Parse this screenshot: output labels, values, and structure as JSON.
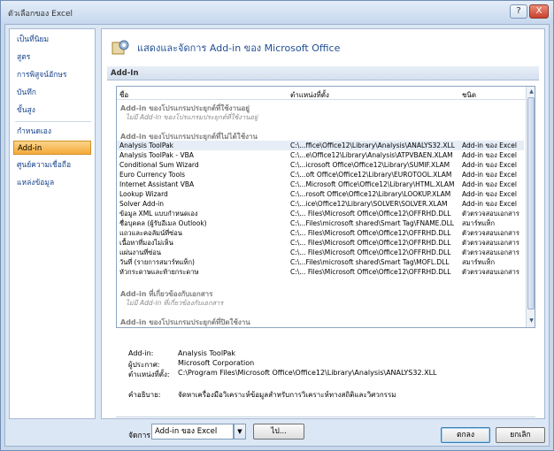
{
  "window": {
    "title": "ตัวเลือกของ Excel",
    "help": "?",
    "close": "X"
  },
  "sidebar": {
    "items": [
      {
        "label": "เป็นที่นิยม"
      },
      {
        "label": "สูตร"
      },
      {
        "label": "การพิสูจน์อักษร"
      },
      {
        "label": "บันทึก"
      },
      {
        "label": "ขั้นสูง"
      },
      {
        "label": "กำหนดเอง"
      },
      {
        "label": "Add-in"
      },
      {
        "label": "ศูนย์ความเชื่อถือ"
      },
      {
        "label": "แหล่งข้อมูล"
      }
    ]
  },
  "header": {
    "text": "แสดงและจัดการ  Add-in ของ Microsoft Office"
  },
  "section": {
    "title": "Add-In"
  },
  "list": {
    "columns": {
      "name": "ชื่อ",
      "location": "ตำแหน่งที่ตั้ง",
      "type": "ชนิด"
    },
    "active_group": {
      "title": "Add-in ของโปรแกรมประยุกต์ที่ใช้งานอยู่",
      "empty": "ไม่มี Add-in ของโปรแกรมประยุกต์ที่ใช้งานอยู่"
    },
    "inactive_group": {
      "title": "Add-in ของโปรแกรมประยุกต์ที่ไม่ได้ใช้งาน"
    },
    "rows": [
      {
        "name": "Analysis ToolPak",
        "location": "C:\\...ffice\\Office12\\Library\\Analysis\\ANALYS32.XLL",
        "type": "Add-in ของ Excel"
      },
      {
        "name": "Analysis ToolPak - VBA",
        "location": "C:\\...e\\Office12\\Library\\Analysis\\ATPVBAEN.XLAM",
        "type": "Add-in ของ Excel"
      },
      {
        "name": "Conditional Sum Wizard",
        "location": "C:\\...icrosoft Office\\Office12\\Library\\SUMIF.XLAM",
        "type": "Add-in ของ Excel"
      },
      {
        "name": "Euro Currency Tools",
        "location": "C:\\...oft Office\\Office12\\Library\\EUROTOOL.XLAM",
        "type": "Add-in ของ Excel"
      },
      {
        "name": "Internet Assistant VBA",
        "location": "C:\\...Microsoft Office\\Office12\\Library\\HTML.XLAM",
        "type": "Add-in ของ Excel"
      },
      {
        "name": "Lookup Wizard",
        "location": "C:\\...rosoft Office\\Office12\\Library\\LOOKUP.XLAM",
        "type": "Add-in ของ Excel"
      },
      {
        "name": "Solver Add-in",
        "location": "C:\\...ice\\Office12\\Library\\SOLVER\\SOLVER.XLAM",
        "type": "Add-in ของ Excel"
      },
      {
        "name": "ข้อมูล XML แบบกำหนดเอง",
        "location": "C:\\... Files\\Microsoft Office\\Office12\\OFFRHD.DLL",
        "type": "ตัวตรวจสอบเอกสาร"
      },
      {
        "name": "ชื่อบุคคล (ผู้รับอีเมล Outlook)",
        "location": "C:\\...Files\\microsoft shared\\Smart Tag\\FNAME.DLL",
        "type": "สมาร์ทแท็ก"
      },
      {
        "name": "แถวและคอลัมน์ที่ซ่อน",
        "location": "C:\\... Files\\Microsoft Office\\Office12\\OFFRHD.DLL",
        "type": "ตัวตรวจสอบเอกสาร"
      },
      {
        "name": "เนื้อหาที่มองไม่เห็น",
        "location": "C:\\... Files\\Microsoft Office\\Office12\\OFFRHD.DLL",
        "type": "ตัวตรวจสอบเอกสาร"
      },
      {
        "name": "แผ่นงานที่ซ่อน",
        "location": "C:\\... Files\\Microsoft Office\\Office12\\OFFRHD.DLL",
        "type": "ตัวตรวจสอบเอกสาร"
      },
      {
        "name": "วันที่ (รายการสมาร์ทแท็ก)",
        "location": "C:\\...Files\\microsoft shared\\Smart Tag\\MOFL.DLL",
        "type": "สมาร์ทแท็ก"
      },
      {
        "name": "หัวกระดาษและท้ายกระดาษ",
        "location": "C:\\... Files\\Microsoft Office\\Office12\\OFFRHD.DLL",
        "type": "ตัวตรวจสอบเอกสาร"
      }
    ],
    "doc_group": {
      "title": "Add-in ที่เกี่ยวข้องกับเอกสาร",
      "empty": "ไม่มี Add-in ที่เกี่ยวข้องกับเอกสาร"
    },
    "disabled_group": {
      "title": "Add-in ของโปรแกรมประยุกต์ที่ปิดใช้งาน"
    }
  },
  "details": {
    "addin_label": "Add-in:",
    "addin_value": "Analysis ToolPak",
    "publisher_label": "ผู้ประกาศ:",
    "publisher_value": "Microsoft Corporation",
    "location_label": "ตำแหน่งที่ตั้ง:",
    "location_value": "C:\\Program Files\\Microsoft Office\\Office12\\Library\\Analysis\\ANALYS32.XLL",
    "description_label": "คำอธิบาย:",
    "description_value": "จัดหาเครื่องมือวิเคราะห์ข้อมูลสำหรับการวิเคราะห์ทางสถิติและวิศวกรรม"
  },
  "manage": {
    "label": "จัดการ:",
    "selected": "Add-in ของ Excel",
    "go": "ไป..."
  },
  "footer": {
    "ok": "ตกลง",
    "cancel": "ยกเลิก"
  }
}
